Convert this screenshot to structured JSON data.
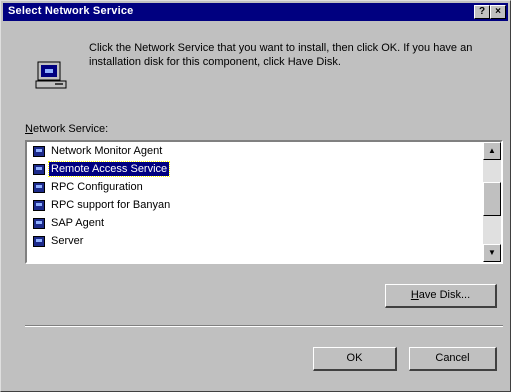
{
  "window": {
    "title": "Select Network Service",
    "help_btn": "?",
    "close_btn": "×"
  },
  "description": "Click the Network Service that you want to install, then click OK. If you have an installation disk for this component, click Have Disk.",
  "list": {
    "label_prefix": "",
    "label_mnemonic": "N",
    "label_rest": "etwork Service:",
    "items": [
      {
        "label": "Network Monitor Agent",
        "selected": false
      },
      {
        "label": "Remote Access Service",
        "selected": true
      },
      {
        "label": "RPC Configuration",
        "selected": false
      },
      {
        "label": "RPC support for Banyan",
        "selected": false
      },
      {
        "label": "SAP Agent",
        "selected": false
      },
      {
        "label": "Server",
        "selected": false
      }
    ],
    "scroll_up_glyph": "▲",
    "scroll_down_glyph": "▼"
  },
  "buttons": {
    "have_disk_mnemonic": "H",
    "have_disk_rest": "ave Disk...",
    "ok": "OK",
    "cancel": "Cancel"
  }
}
